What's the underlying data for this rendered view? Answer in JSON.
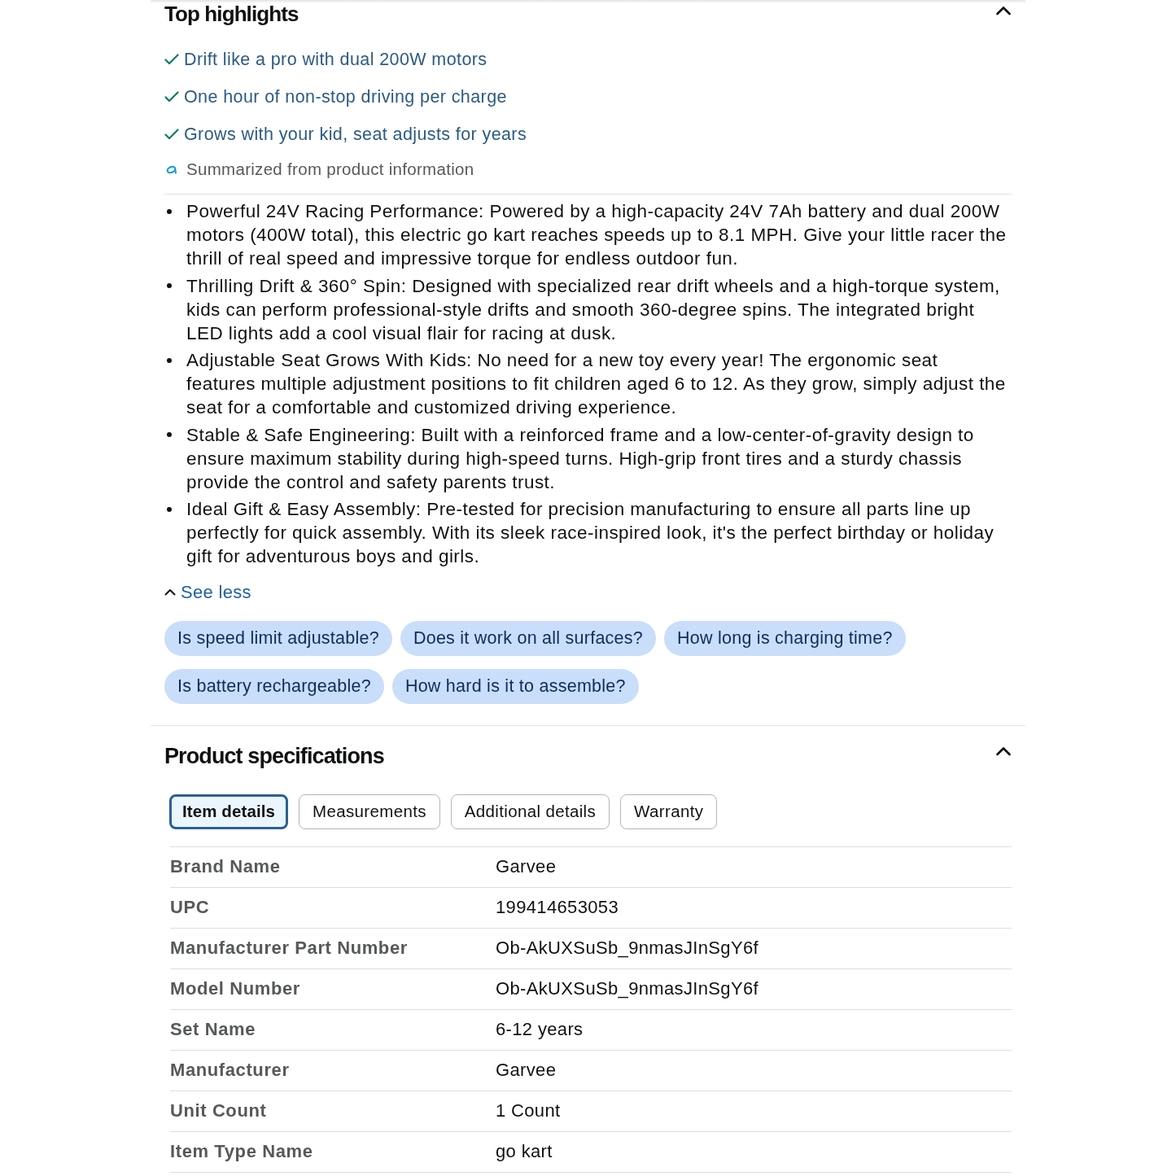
{
  "highlights": {
    "title": "Top highlights",
    "expanded": true,
    "items": [
      "Drift like a pro with dual 200W motors",
      "One hour of non-stop driving per charge",
      "Grows with your kid, seat adjusts for years"
    ],
    "summary_note": "Summarized from product information",
    "features": [
      "Powerful 24V Racing Performance: Powered by a high-capacity 24V 7Ah battery and dual 200W motors (400W total), this electric go kart reaches speeds up to 8.1 MPH. Give your little racer the thrill of real speed and impressive torque for endless outdoor fun.",
      "Thrilling Drift & 360° Spin: Designed with specialized rear drift wheels and a high-torque system, kids can perform professional-style drifts and smooth 360-degree spins. The integrated bright LED lights add a cool visual flair for racing at dusk.",
      "Adjustable Seat Grows With Kids: No need for a new toy every year! The ergonomic seat features multiple adjustment positions to fit children aged 6 to 12. As they grow, simply adjust the seat for a comfortable and customized driving experience.",
      "Stable & Safe Engineering: Built with a reinforced frame and a low-center-of-gravity design to ensure maximum stability during high-speed turns. High-grip front tires and a sturdy chassis provide the control and safety parents trust.",
      "Ideal Gift & Easy Assembly: Pre-tested for precision manufacturing to ensure all parts line up perfectly for quick assembly. With its sleek race-inspired look, it's the perfect birthday or holiday gift for adventurous boys and girls."
    ],
    "see_less": "See less",
    "questions": [
      "Is speed limit adjustable?",
      "Does it work on all surfaces?",
      "How long is charging time?",
      "Is battery rechargeable?",
      "How hard is it to assemble?"
    ]
  },
  "specifications": {
    "title": "Product specifications",
    "expanded": true,
    "tabs": [
      {
        "label": "Item details",
        "selected": true
      },
      {
        "label": "Measurements",
        "selected": false
      },
      {
        "label": "Additional details",
        "selected": false
      },
      {
        "label": "Warranty",
        "selected": false
      }
    ],
    "rows": [
      {
        "label": "Brand Name",
        "value": "Garvee"
      },
      {
        "label": "UPC",
        "value": "199414653053"
      },
      {
        "label": "Manufacturer Part Number",
        "value": "Ob-AkUXSuSb_9nmasJInSgY6f"
      },
      {
        "label": "Model Number",
        "value": "Ob-AkUXSuSb_9nmasJInSgY6f"
      },
      {
        "label": "Set Name",
        "value": "6-12 years"
      },
      {
        "label": "Manufacturer",
        "value": "Garvee"
      },
      {
        "label": "Unit Count",
        "value": "1 Count"
      },
      {
        "label": "Item Type Name",
        "value": "go kart"
      }
    ]
  }
}
